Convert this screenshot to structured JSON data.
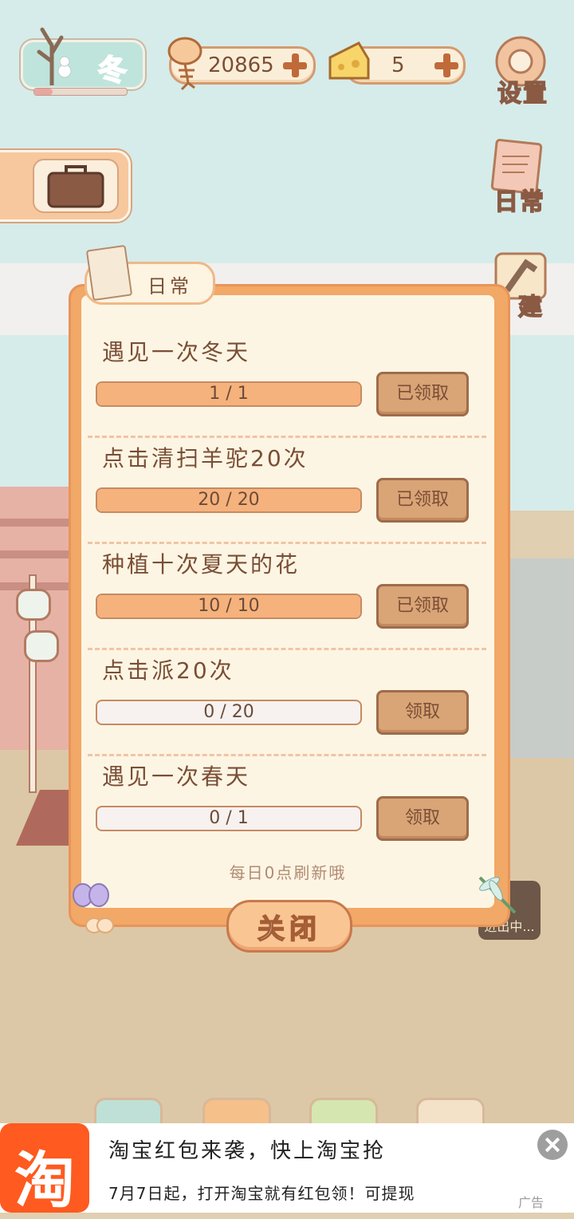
{
  "top_bar": {
    "season_label": "冬",
    "season_progress": 0.2,
    "fish_count": "20865",
    "cheese_count": "5",
    "settings_label": "设置",
    "daily_label": "日常",
    "build_label": "建",
    "status_hint": "进出中..."
  },
  "dialog": {
    "tab_label": "日常",
    "tasks": [
      {
        "title": "遇见一次冬天",
        "progress_text": "1 / 1",
        "progress": 1,
        "button": "已领取",
        "claimed": true
      },
      {
        "title": "点击清扫羊驼20次",
        "progress_text": "20 / 20",
        "progress": 1,
        "button": "已领取",
        "claimed": true
      },
      {
        "title": "种植十次夏天的花",
        "progress_text": "10 / 10",
        "progress": 1,
        "button": "已领取",
        "claimed": true
      },
      {
        "title": "点击派20次",
        "progress_text": "0 / 20",
        "progress": 0,
        "button": "领取",
        "claimed": false
      },
      {
        "title": "遇见一次春天",
        "progress_text": "0 / 1",
        "progress": 0,
        "button": "领取",
        "claimed": false
      }
    ],
    "footer_note": "每日0点刷新哦",
    "close_label": "关闭"
  },
  "ad": {
    "logo_char": "淘",
    "title": "淘宝红包来袭，快上淘宝抢",
    "subtitle": "7月7日起，打开淘宝就有红包领！可提现",
    "tag": "广告"
  },
  "colors": {
    "dialog_frame": "#f2a866",
    "dialog_bg": "#fdf5e3",
    "progress_fill": "#f6b27c",
    "ad_brand": "#ff5a1f"
  }
}
